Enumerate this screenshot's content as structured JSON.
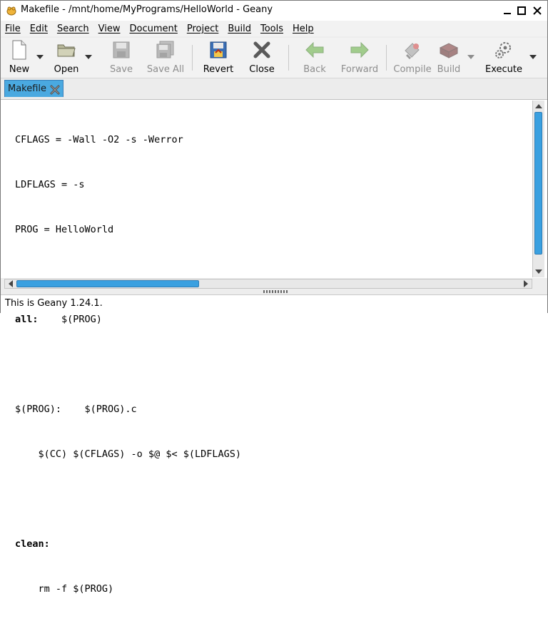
{
  "window": {
    "title": "Makefile - /mnt/home/MyPrograms/HelloWorld - Geany"
  },
  "menu": [
    "File",
    "Edit",
    "Search",
    "View",
    "Document",
    "Project",
    "Build",
    "Tools",
    "Help"
  ],
  "toolbar": {
    "new": "New",
    "open": "Open",
    "save": "Save",
    "save_all": "Save All",
    "revert": "Revert",
    "close": "Close",
    "back": "Back",
    "forward": "Forward",
    "compile": "Compile",
    "build": "Build",
    "execute": "Execute"
  },
  "tabs": [
    {
      "label": "Makefile"
    }
  ],
  "editor": {
    "lines": [
      {
        "kw": "",
        "rest": "CFLAGS = -Wall -O2 -s -Werror"
      },
      {
        "kw": "",
        "rest": "LDFLAGS = -s"
      },
      {
        "kw": "",
        "rest": "PROG = HelloWorld"
      },
      {
        "kw": "",
        "rest": ""
      },
      {
        "kw": "all:",
        "rest": "    $(PROG)"
      },
      {
        "kw": "",
        "rest": ""
      },
      {
        "kw": "",
        "rest": "$(PROG):    $(PROG).c"
      },
      {
        "kw": "",
        "rest": "    $(CC) $(CFLAGS) -o $@ $< $(LDFLAGS)"
      },
      {
        "kw": "",
        "rest": ""
      },
      {
        "kw": "clean:",
        "rest": ""
      },
      {
        "kw": "",
        "rest": "    rm -f $(PROG)"
      }
    ]
  },
  "status": {
    "message": "This is Geany 1.24.1."
  },
  "colors": {
    "accent": "#3aa0e0",
    "tab_active": "#4aa9e0"
  }
}
